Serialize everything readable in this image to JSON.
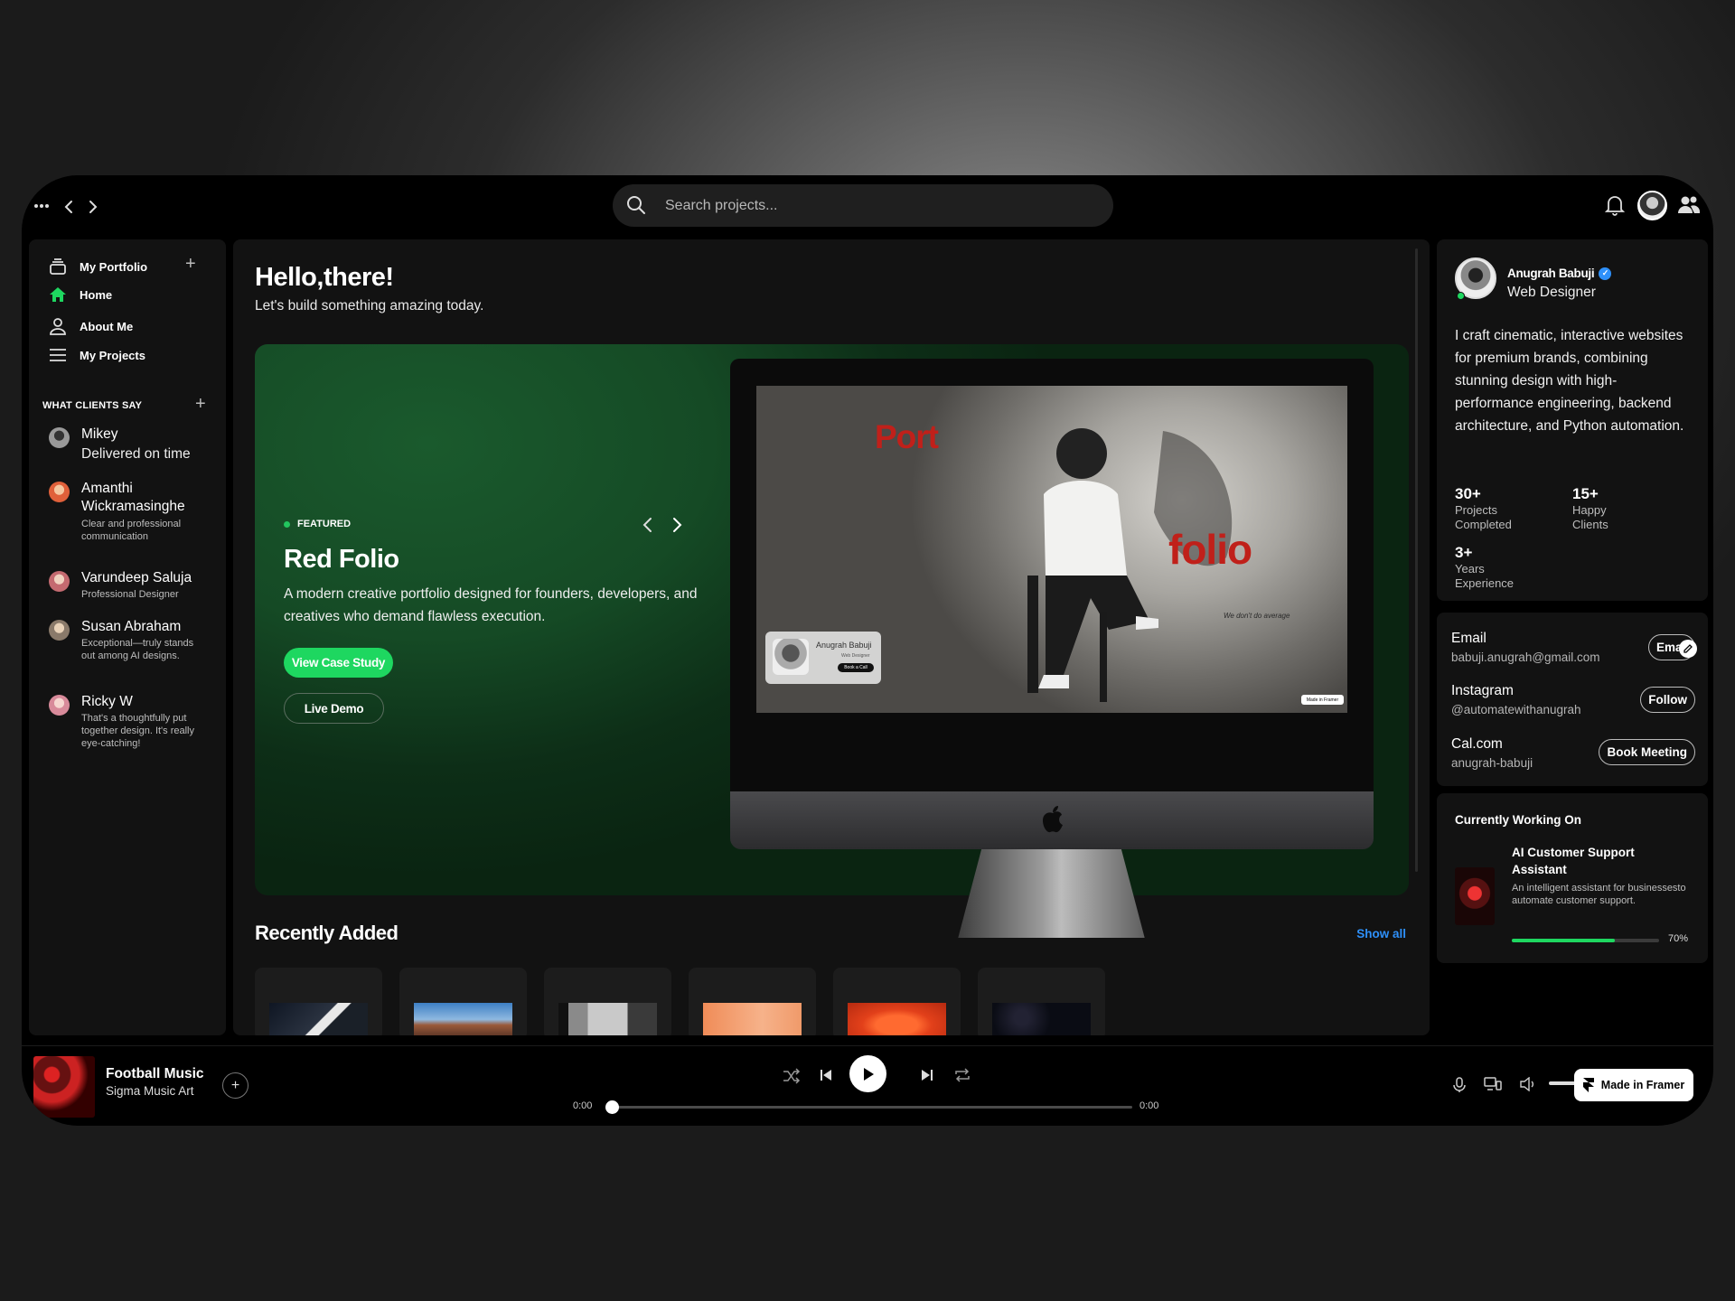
{
  "search": {
    "placeholder": "Search projects..."
  },
  "sidebar": {
    "library_label": "My Portfolio",
    "nav": [
      {
        "label": "Home",
        "icon": "home-icon"
      },
      {
        "label": "About Me",
        "icon": "user-icon"
      },
      {
        "label": "My Projects",
        "icon": "list-icon"
      }
    ],
    "clients_section": "WHAT CLIENTS SAY",
    "clients": [
      {
        "name": "Mikey",
        "quote": "Delivered on time"
      },
      {
        "name": "Amanthi Wickramasinghe",
        "quote": "Clear and professional communication"
      },
      {
        "name": "Varundeep Saluja",
        "quote": "Professional Designer"
      },
      {
        "name": "Susan Abraham",
        "quote": "Exceptional—truly stands out among AI designs."
      },
      {
        "name": "Ricky W",
        "quote": "That's a thoughtfully put together design. It's really eye-catching!"
      }
    ]
  },
  "main": {
    "greeting": "Hello,there!",
    "subtitle": "Let's build something amazing today.",
    "featured": {
      "tag": "FEATURED",
      "title": "Red Folio",
      "description": "A modern creative portfolio designed for founders, developers, and creatives who demand flawless execution.",
      "primary_button": "View Case Study",
      "secondary_button": "Live Demo",
      "screen": {
        "word1": "Port",
        "word2": "folio",
        "tagline": "We don't do average",
        "card_name": "Anugrah Babuji",
        "card_role": "Web Designer",
        "card_button": "Book a Call",
        "framer": "Made in Framer"
      }
    },
    "recent_title": "Recently Added",
    "show_all": "Show all"
  },
  "profile": {
    "name": "Anugrah Babuji",
    "role": "Web Designer",
    "bio": "I craft cinematic, interactive websites for premium brands, combining stunning design with high-performance engineering, backend architecture, and Python automation.",
    "stats": [
      {
        "value": "30+",
        "label": "Projects Completed"
      },
      {
        "value": "15+",
        "label": "Happy Clients"
      },
      {
        "value": "3+",
        "label": "Years Experience"
      }
    ]
  },
  "contacts": [
    {
      "key": "Email",
      "value": "babuji.anugrah@gmail.com",
      "button": "Ema"
    },
    {
      "key": "Instagram",
      "value": "@automatewithanugrah",
      "button": "Follow"
    },
    {
      "key": "Cal.com",
      "value": "anugrah-babuji",
      "button": "Book Meeting"
    }
  ],
  "working": {
    "title": "Currently Working On",
    "project": "AI Customer Support Assistant",
    "description": "An intelligent assistant for businessesto automate customer support.",
    "progress_label": "70%",
    "progress": 0.7
  },
  "player": {
    "title": "Football Music",
    "artist": "Sigma Music Art",
    "time_current": "0:00",
    "time_total": "0:00",
    "badge": "Made in Framer"
  },
  "colors": {
    "accent": "#1ed760",
    "link": "#2e90fa",
    "hero": "#154a25"
  }
}
